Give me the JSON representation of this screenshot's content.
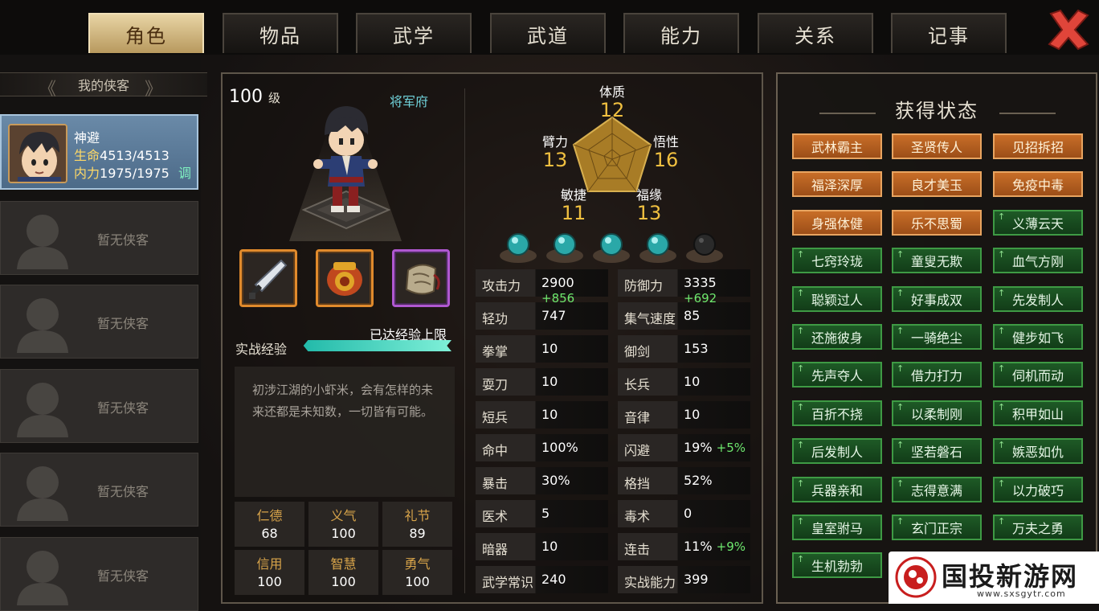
{
  "tabs": [
    {
      "label": "角色",
      "active": true
    },
    {
      "label": "物品",
      "active": false
    },
    {
      "label": "武学",
      "active": false
    },
    {
      "label": "武道",
      "active": false
    },
    {
      "label": "能力",
      "active": false
    },
    {
      "label": "关系",
      "active": false
    },
    {
      "label": "记事",
      "active": false
    }
  ],
  "roster": {
    "header": "我的侠客",
    "hero": {
      "name": "神避",
      "hp_label": "生命",
      "hp": "4513/4513",
      "mp_label": "内力",
      "mp": "1975/1975",
      "tune": "调"
    },
    "empty_label": "暂无侠客"
  },
  "character": {
    "level": "100",
    "level_unit": "级",
    "faction": "将军府",
    "exp_label": "实战经验",
    "exp_status": "已达经验上限",
    "exp_fill": 1.0,
    "description": "初涉江湖的小虾米，会有怎样的未来还都是未知数，一切皆有可能。",
    "virtues": [
      {
        "name": "仁德",
        "value": "68"
      },
      {
        "name": "义气",
        "value": "100"
      },
      {
        "name": "礼节",
        "value": "89"
      },
      {
        "name": "信用",
        "value": "100"
      },
      {
        "name": "智慧",
        "value": "100"
      },
      {
        "name": "勇气",
        "value": "100"
      }
    ]
  },
  "attributes": {
    "tizhi": {
      "name": "体质",
      "value": "12"
    },
    "bili": {
      "name": "臂力",
      "value": "13"
    },
    "wuxing": {
      "name": "悟性",
      "value": "16"
    },
    "minjie": {
      "name": "敏捷",
      "value": "11"
    },
    "fuyuan": {
      "name": "福缘",
      "value": "13"
    }
  },
  "orbs": {
    "filled": 4,
    "total": 5
  },
  "stats_left": [
    {
      "name": "攻击力",
      "value": "2900",
      "bonus": "+856"
    },
    {
      "name": "轻功",
      "value": "747",
      "bonus": ""
    },
    {
      "name": "拳掌",
      "value": "10",
      "bonus": ""
    },
    {
      "name": "耍刀",
      "value": "10",
      "bonus": ""
    },
    {
      "name": "短兵",
      "value": "10",
      "bonus": ""
    },
    {
      "name": "命中",
      "value": "100%",
      "bonus": ""
    },
    {
      "name": "暴击",
      "value": "30%",
      "bonus": ""
    },
    {
      "name": "医术",
      "value": "5",
      "bonus": ""
    },
    {
      "name": "暗器",
      "value": "10",
      "bonus": ""
    },
    {
      "name": "武学常识",
      "value": "240",
      "bonus": ""
    }
  ],
  "stats_right": [
    {
      "name": "防御力",
      "value": "3335",
      "bonus": "+692"
    },
    {
      "name": "集气速度",
      "value": "85",
      "bonus": ""
    },
    {
      "name": "御剑",
      "value": "153",
      "bonus": ""
    },
    {
      "name": "长兵",
      "value": "10",
      "bonus": ""
    },
    {
      "name": "音律",
      "value": "10",
      "bonus": ""
    },
    {
      "name": "闪避",
      "value": "19%",
      "bonus": "+5%"
    },
    {
      "name": "格挡",
      "value": "52%",
      "bonus": ""
    },
    {
      "name": "毒术",
      "value": "0",
      "bonus": ""
    },
    {
      "name": "连击",
      "value": "11%",
      "bonus": "+9%"
    },
    {
      "name": "实战能力",
      "value": "399",
      "bonus": ""
    }
  ],
  "status": {
    "title": "获得状态",
    "buffs": [
      {
        "label": "武林霸主",
        "type": "gold"
      },
      {
        "label": "圣贤传人",
        "type": "gold"
      },
      {
        "label": "见招拆招",
        "type": "gold"
      },
      {
        "label": "福泽深厚",
        "type": "gold"
      },
      {
        "label": "良才美玉",
        "type": "gold"
      },
      {
        "label": "免疫中毒",
        "type": "gold"
      },
      {
        "label": "身强体健",
        "type": "gold"
      },
      {
        "label": "乐不思蜀",
        "type": "gold"
      },
      {
        "label": "义薄云天",
        "type": "green"
      },
      {
        "label": "七窍玲珑",
        "type": "green"
      },
      {
        "label": "童叟无欺",
        "type": "green"
      },
      {
        "label": "血气方刚",
        "type": "green"
      },
      {
        "label": "聪颖过人",
        "type": "green"
      },
      {
        "label": "好事成双",
        "type": "green"
      },
      {
        "label": "先发制人",
        "type": "green"
      },
      {
        "label": "还施彼身",
        "type": "green"
      },
      {
        "label": "一骑绝尘",
        "type": "green"
      },
      {
        "label": "健步如飞",
        "type": "green"
      },
      {
        "label": "先声夺人",
        "type": "green"
      },
      {
        "label": "借力打力",
        "type": "green"
      },
      {
        "label": "伺机而动",
        "type": "green"
      },
      {
        "label": "百折不挠",
        "type": "green"
      },
      {
        "label": "以柔制刚",
        "type": "green"
      },
      {
        "label": "积甲如山",
        "type": "green"
      },
      {
        "label": "后发制人",
        "type": "green"
      },
      {
        "label": "坚若磐石",
        "type": "green"
      },
      {
        "label": "嫉恶如仇",
        "type": "green"
      },
      {
        "label": "兵器亲和",
        "type": "green"
      },
      {
        "label": "志得意满",
        "type": "green"
      },
      {
        "label": "以力破巧",
        "type": "green"
      },
      {
        "label": "皇室驸马",
        "type": "green"
      },
      {
        "label": "玄门正宗",
        "type": "green"
      },
      {
        "label": "万夫之勇",
        "type": "green"
      },
      {
        "label": "生机勃勃",
        "type": "green"
      }
    ]
  },
  "watermark": {
    "text": "国投新游网",
    "url": "www.sxsgytr.com"
  }
}
